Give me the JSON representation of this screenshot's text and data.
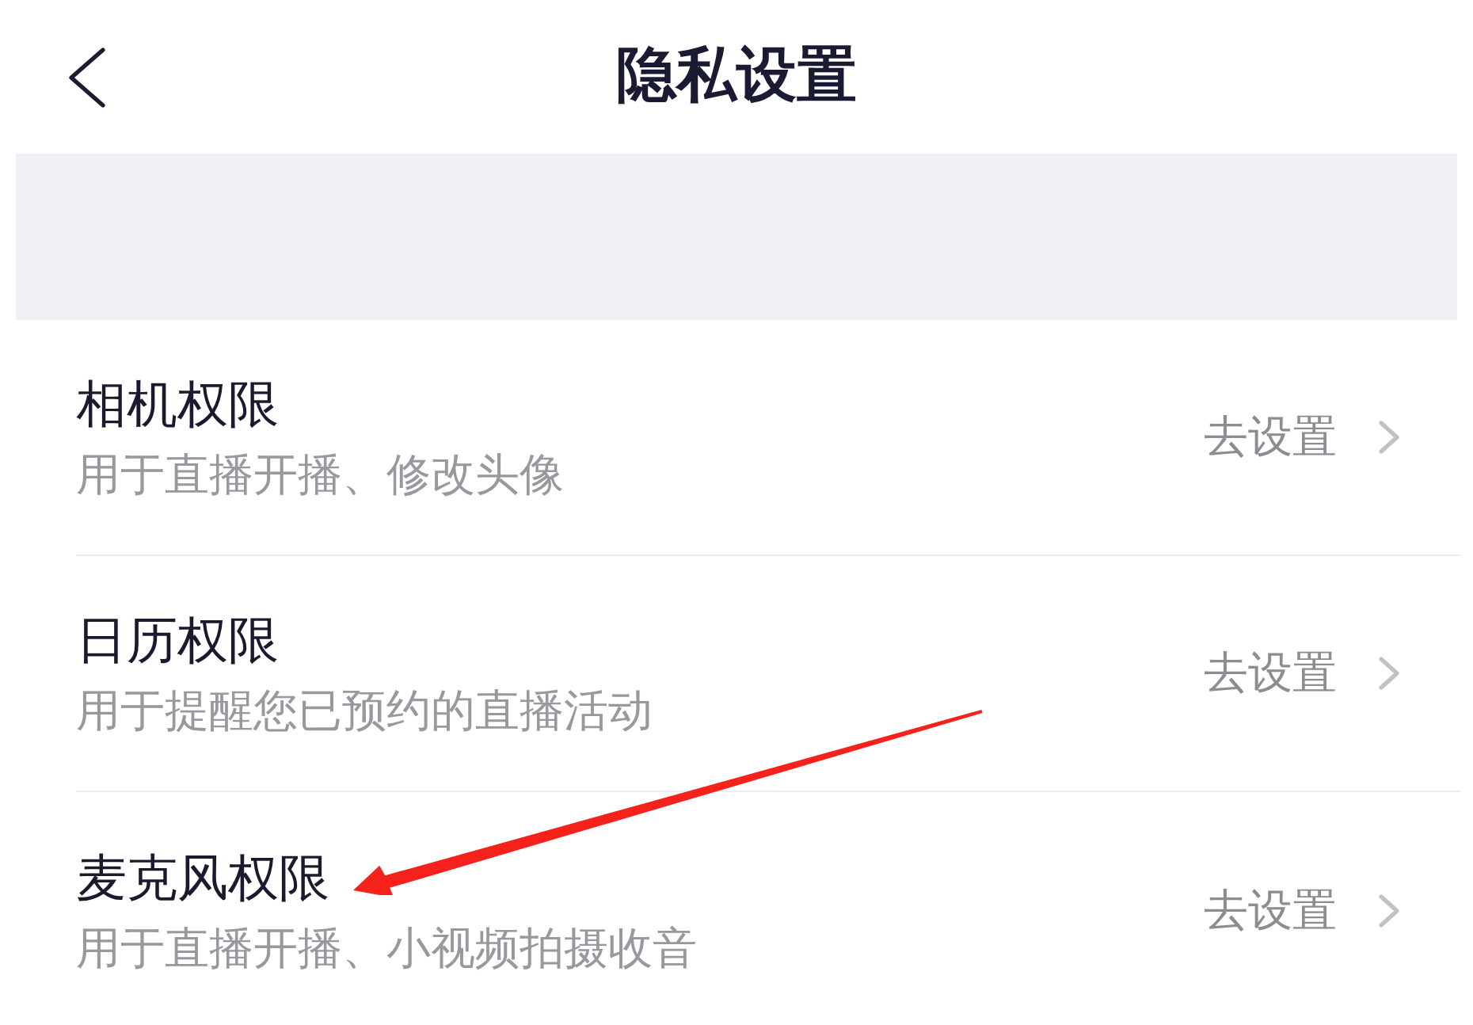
{
  "header": {
    "title": "隐私设置"
  },
  "permissions": [
    {
      "title": "相机权限",
      "description": "用于直播开播、修改头像",
      "action": "去设置"
    },
    {
      "title": "日历权限",
      "description": "用于提醒您已预约的直播活动",
      "action": "去设置"
    },
    {
      "title": "麦克风权限",
      "description": "用于直播开播、小视频拍摄收音",
      "action": "去设置"
    }
  ]
}
